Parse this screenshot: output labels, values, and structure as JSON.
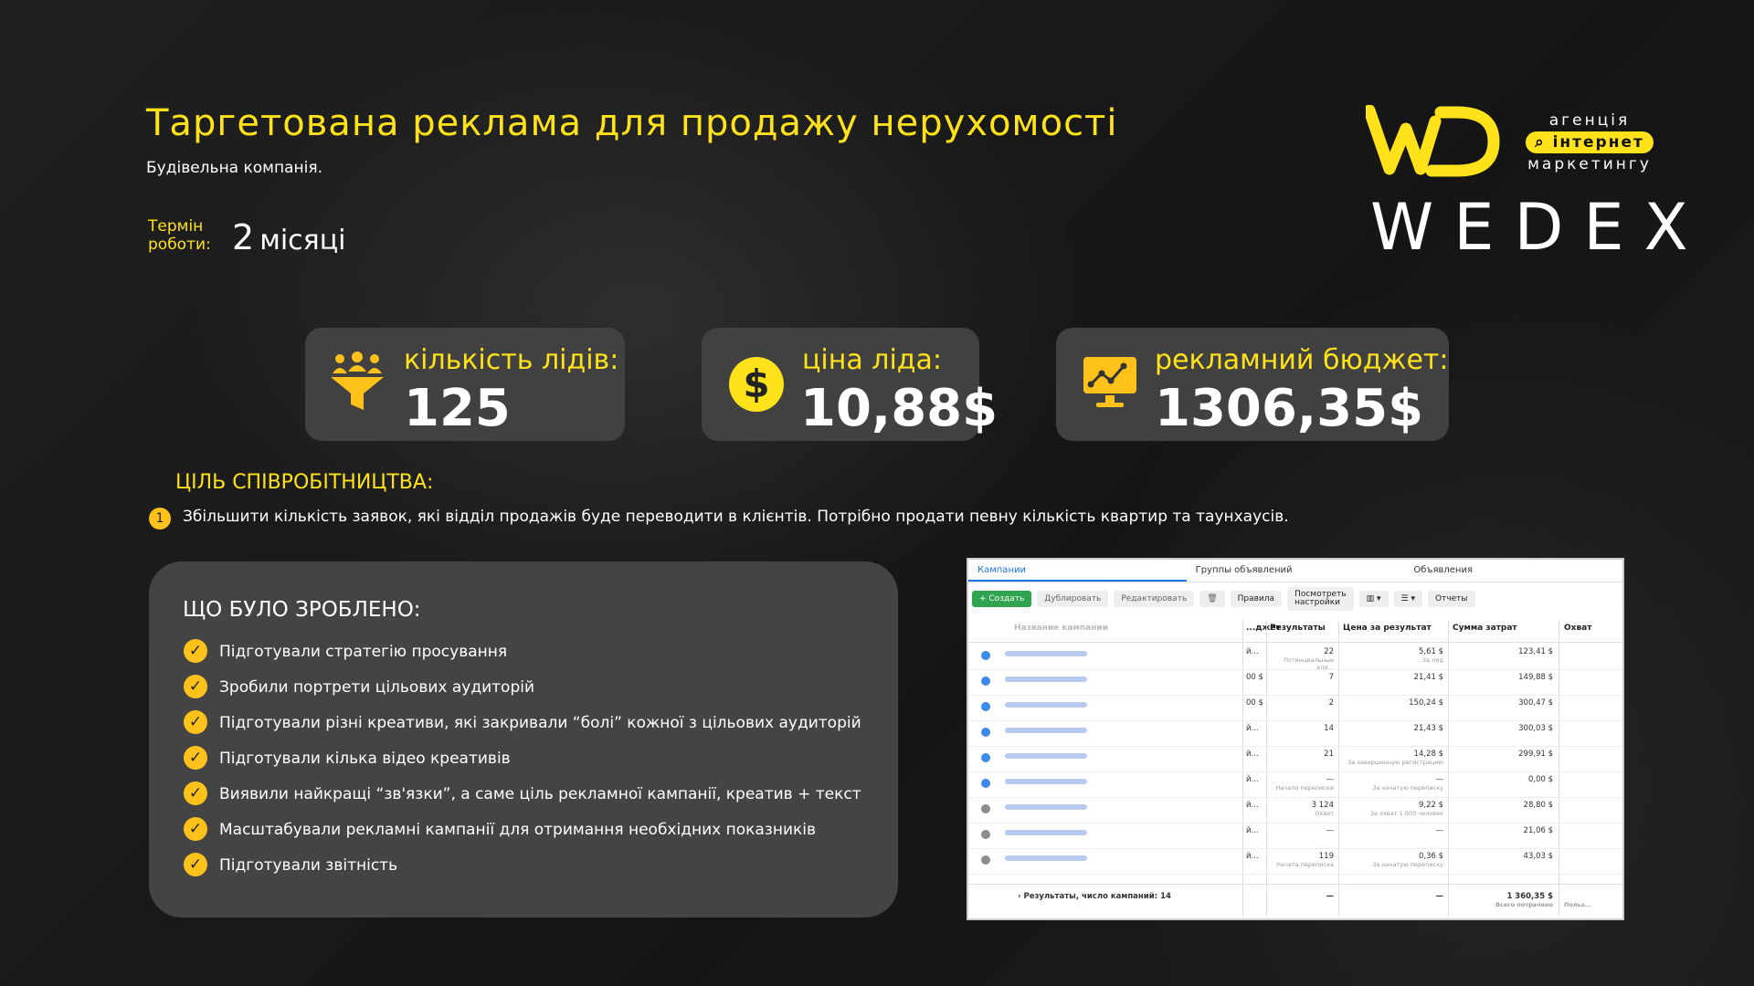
{
  "header": {
    "title": "Таргетована реклама для продажу нерухомості",
    "subtitle": "Будівельна компанія.",
    "term_label_1": "Термін",
    "term_label_2": "роботи:",
    "term_value": "2",
    "term_unit": "місяці"
  },
  "logo": {
    "tag_line_1": "агенція",
    "tag_line_2": "інтернет",
    "tag_line_3": "маркетингу",
    "brand": "WEDEX",
    "brand_color": "#ffe21a"
  },
  "kpis": [
    {
      "label": "кількість лідів:",
      "value": "125",
      "icon": "funnel-people-icon"
    },
    {
      "label": "ціна ліда:",
      "value": "10,88$",
      "icon": "dollar-coin-icon"
    },
    {
      "label": "рекламний бюджет:",
      "value": "1306,35$",
      "icon": "monitor-chart-icon"
    }
  ],
  "goal": {
    "title": "ЦІЛЬ СПІВРОБІТНИЦТВА:",
    "number": "1",
    "text": "Збільшити кількість заявок, які відділ продажів буде переводити в клієнтів. Потрібно продати певну кількість квартир та таунхаусів."
  },
  "done": {
    "title": "ЩО БУЛО ЗРОБЛЕНО:",
    "items": [
      "Підготували стратегію просування",
      "Зробили портрети цільових аудиторій",
      "Підготували різні креативи, які закривали “болі” кожної з цільових аудиторій",
      "Підготували кілька відео креативів",
      "Виявили найкращі “зв'язки”, а саме ціль рекламної кампанії, креатив + текст",
      "Масштабували рекламні кампанії для отримання необхідних показників",
      "Підготували звітність"
    ]
  },
  "screenshot": {
    "tabs": [
      "Кампании",
      "Группы объявлений",
      "Объявления"
    ],
    "toolbar": {
      "create": "+ Создать",
      "duplicate": "Дублировать",
      "edit": "Редактировать",
      "rules": "Правила",
      "view_settings_1": "Посмотреть",
      "view_settings_2": "настройки",
      "reports": "Отчеты"
    },
    "columns": [
      "Название кампании",
      "...джет",
      "Результаты",
      "Цена за результат",
      "Сумма затрат",
      "Охват"
    ],
    "rows": [
      {
        "budget": "й...",
        "results": "22",
        "results_sub": "Потенциальные кли...",
        "cost": "5,61 $",
        "cost_sub": "За лид",
        "spend": "123,41 $"
      },
      {
        "budget": "00 $",
        "results": "7",
        "results_sub": "",
        "cost": "21,41 $",
        "cost_sub": "",
        "spend": "149,88 $"
      },
      {
        "budget": "00 $",
        "results": "2",
        "results_sub": "",
        "cost": "150,24 $",
        "cost_sub": "",
        "spend": "300,47 $"
      },
      {
        "budget": "й...",
        "results": "14",
        "results_sub": "",
        "cost": "21,43 $",
        "cost_sub": "",
        "spend": "300,03 $"
      },
      {
        "budget": "й...",
        "results": "21",
        "results_sub": "",
        "cost": "14,28 $",
        "cost_sub": "За завершенную регистрацию",
        "spend": "299,91 $"
      },
      {
        "budget": "й...",
        "results": "—",
        "results_sub": "Начало переписки",
        "cost": "—",
        "cost_sub": "За начатую переписку",
        "spend": "0,00 $"
      },
      {
        "budget": "й...",
        "results": "3 124",
        "results_sub": "Охват",
        "cost": "9,22 $",
        "cost_sub": "За охват 1 000 человек",
        "spend": "28,80 $"
      },
      {
        "budget": "й...",
        "results": "—",
        "results_sub": "",
        "cost": "—",
        "cost_sub": "",
        "spend": "21,06 $"
      },
      {
        "budget": "й...",
        "results": "119",
        "results_sub": "Начата переписка",
        "cost": "0,36 $",
        "cost_sub": "За начатую переписку",
        "spend": "43,03 $"
      }
    ],
    "footer": {
      "label": "Результаты, число кампаний: 14",
      "results": "—",
      "cost": "—",
      "spend": "1 360,35 $",
      "spend_sub": "Всего потрачено",
      "reach_sub": "Польз..."
    }
  }
}
